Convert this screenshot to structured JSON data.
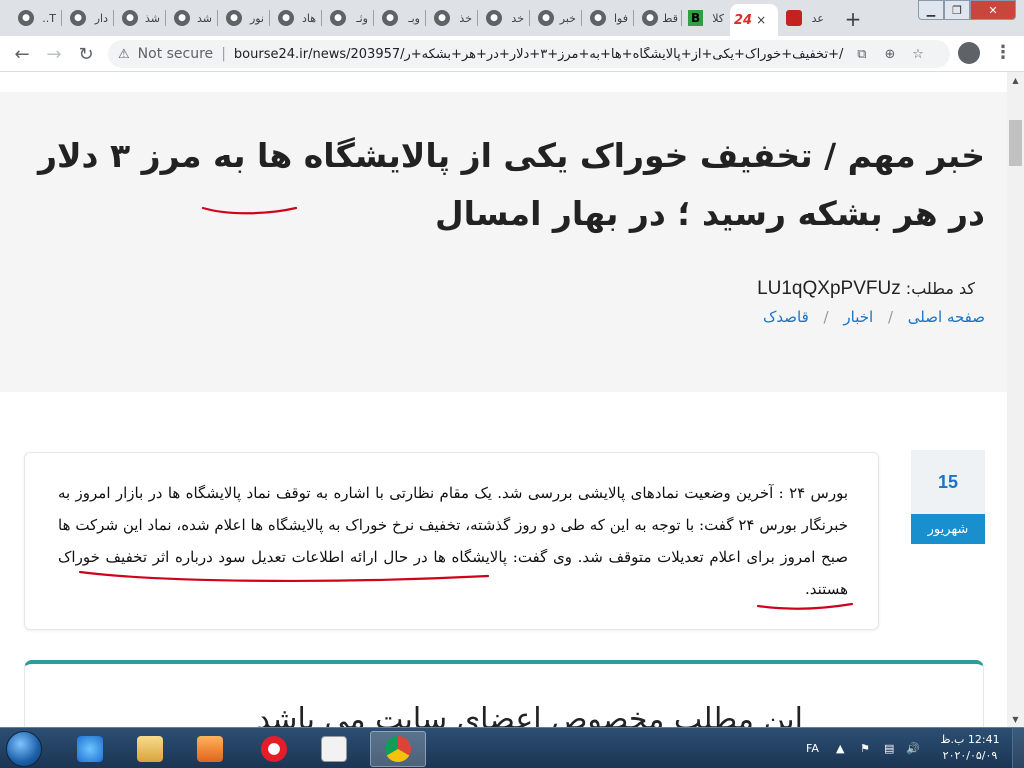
{
  "browser": {
    "tabs": [
      {
        "title": "T..",
        "icon": "globe-icon"
      },
      {
        "title": "دار",
        "icon": "globe-icon"
      },
      {
        "title": "شذ",
        "icon": "globe-icon"
      },
      {
        "title": "شد",
        "icon": "globe-icon"
      },
      {
        "title": "نور",
        "icon": "globe-icon"
      },
      {
        "title": "هاد",
        "icon": "globe-icon"
      },
      {
        "title": "وثـ",
        "icon": "globe-icon"
      },
      {
        "title": "وبـ",
        "icon": "globe-icon"
      },
      {
        "title": "خذ",
        "icon": "globe-icon"
      },
      {
        "title": "خد",
        "icon": "globe-icon"
      },
      {
        "title": "خبر",
        "icon": "globe-icon"
      },
      {
        "title": "فوا",
        "icon": "globe-icon"
      },
      {
        "title": "قط",
        "icon": "globe-icon"
      },
      {
        "title": "كلا",
        "icon": "b-logo-icon"
      },
      {
        "title": "×",
        "icon": "bourse24-logo-icon"
      },
      {
        "title": "عد",
        "icon": "red-logo-icon"
      }
    ],
    "new_tab": "+",
    "address": {
      "security": "Not secure",
      "url": "bourse24.ir/news/203957/خبر+مهم+/+تخفیف+خوراک+یکی+از+پالایشگاه+ها+به+مرز+۳+دلار+در+هر+بشکه+ر..."
    }
  },
  "article": {
    "title": "خبر مهم / تخفیف خوراک یکی از پالایشگاه ها به مرز ۳ دلار در هر بشکه رسید ؛ در بهار امسال",
    "code_label": "کد مطلب:",
    "code_value": "LU1qQXpPVFUz",
    "breadcrumbs": [
      "صفحه اصلی",
      "اخبار",
      "قاصدک"
    ],
    "date_day": "15",
    "date_month": "شهریور",
    "body": "بورس ۲۴ : آخرین وضعیت نمادهای پالایشی بررسی شد. یک مقام نظارتی با اشاره به توقف نماد پالایشگاه ها در بازار امروز به خبرنگار بورس ۲۴ گفت: با توجه به این که طی دو روز گذشته، تخفیف نرخ خوراک به پالایشگاه ها اعلام شده، نماد این شرکت ها صبح امروز برای اعلام تعدیلات متوقف شد. وی گفت: پالایشگاه ها در حال ارائه اطلاعات تعدیل سود درباره اثر تخفیف خوراک هستند.",
    "members_notice": "این مطلب مخصوص اعضای سایت می باشد"
  },
  "taskbar": {
    "lang": "FA",
    "time": "12:41 ب.ظ",
    "date": "۲۰۲۰/۰۵/۰۹"
  },
  "colors": {
    "link": "#1a73c5",
    "accent_teal": "#2a9d9a",
    "date_badge": "#1a8fce",
    "annotation_red": "#d0021b"
  }
}
